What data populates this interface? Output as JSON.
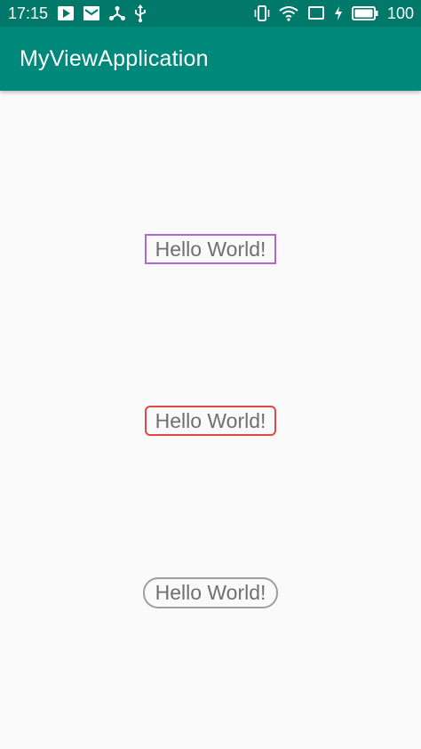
{
  "status_bar": {
    "time": "17:15",
    "battery_level": "100",
    "icons_left": [
      "play-icon",
      "mail-icon",
      "share-icon",
      "usb-icon"
    ],
    "icons_right": [
      "vibrate-icon",
      "wifi-icon",
      "cast-icon",
      "charging-icon",
      "battery-icon"
    ],
    "background_color": "#00796b"
  },
  "app_bar": {
    "title": "MyViewApplication",
    "background_color": "#00897b"
  },
  "content": {
    "labels": [
      {
        "text": "Hello World!",
        "border_style": "rectangle",
        "border_color": "#ab6bc7"
      },
      {
        "text": "Hello World!",
        "border_style": "rounded",
        "border_color": "#e04848"
      },
      {
        "text": "Hello World!",
        "border_style": "pill",
        "border_color": "#9e9e9e"
      }
    ]
  }
}
